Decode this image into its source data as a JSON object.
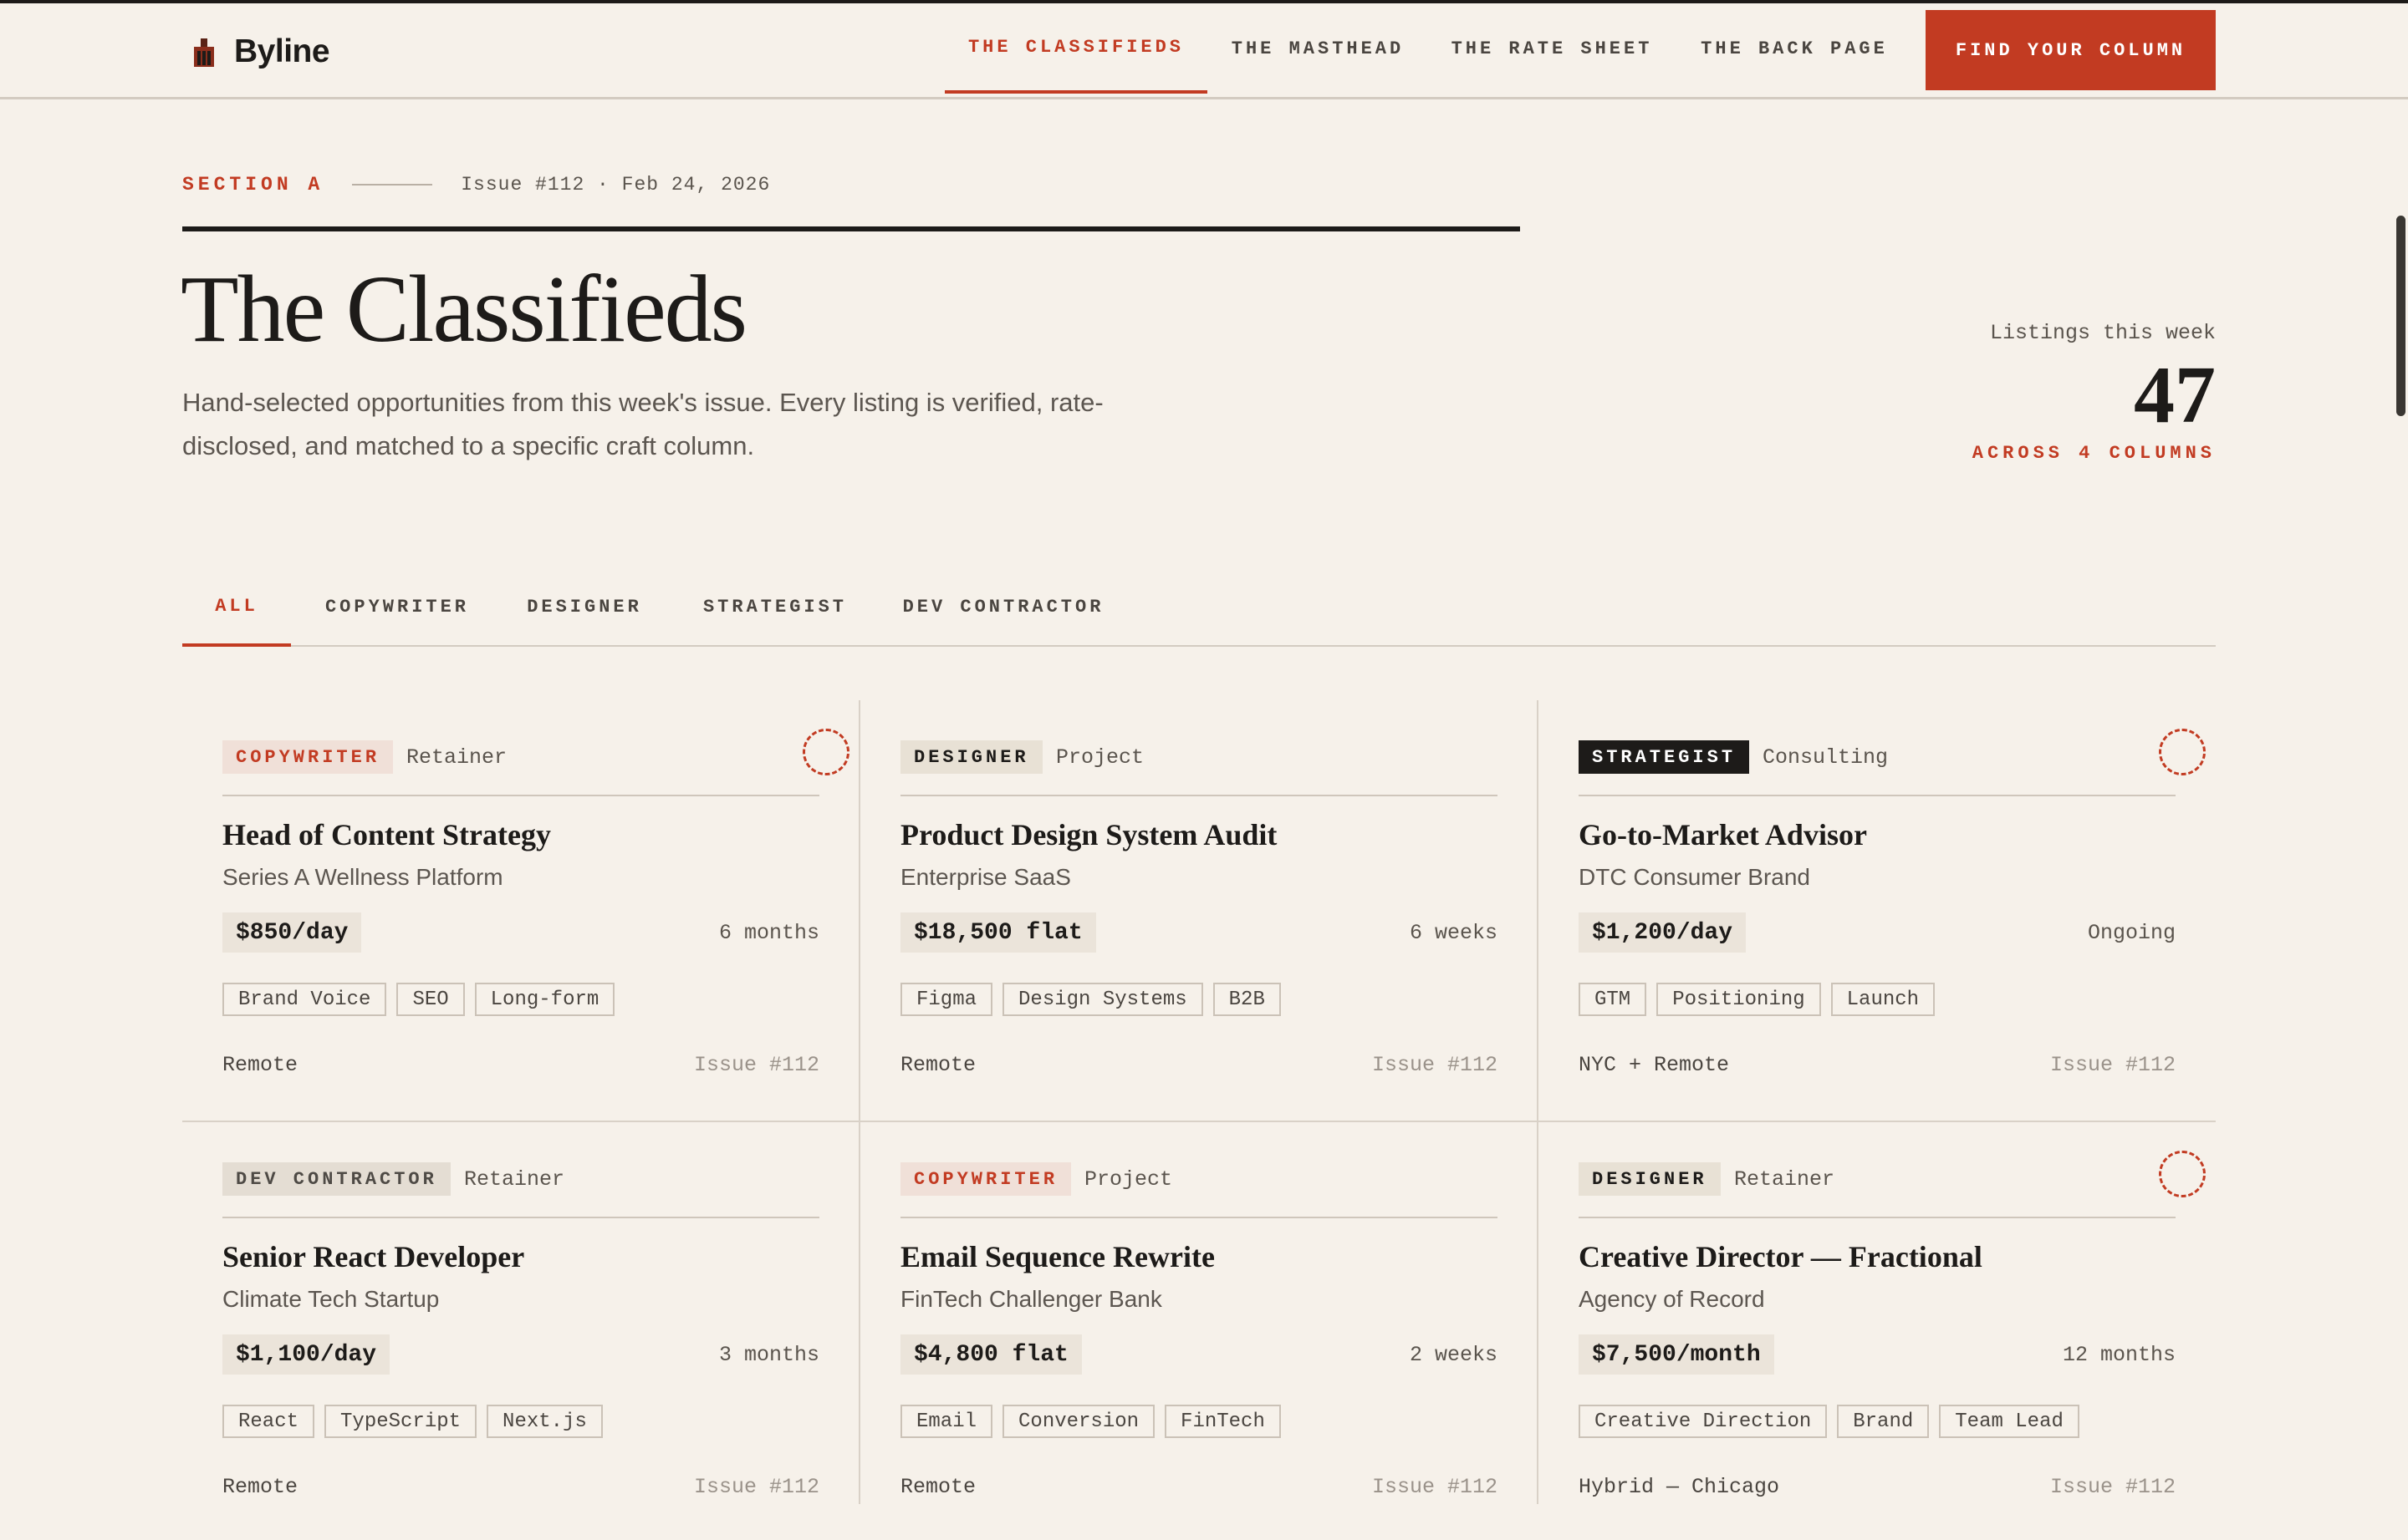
{
  "brand": {
    "name": "Byline",
    "logo_icon": "building-icon"
  },
  "nav": {
    "links": [
      "THE CLASSIFIEDS",
      "THE MASTHEAD",
      "THE RATE SHEET",
      "THE BACK PAGE"
    ],
    "active_index": 0,
    "cta": "FIND YOUR COLUMN"
  },
  "header": {
    "section": "SECTION A",
    "issue": "Issue #112 · Feb 24, 2026",
    "title": "The Classifieds",
    "description": "Hand-selected opportunities from this week's issue. Every listing is verified, rate-disclosed, and matched to a specific craft column.",
    "stat_label": "Listings this week",
    "stat_value": "47",
    "stat_sub": "ACROSS 4 COLUMNS"
  },
  "filters": {
    "tabs": [
      "ALL",
      "COPYWRITER",
      "DESIGNER",
      "STRATEGIST",
      "DEV CONTRACTOR"
    ],
    "active_index": 0
  },
  "listings": [
    {
      "category": "COPYWRITER",
      "type": "Retainer",
      "saved_marker": true,
      "title": "Head of Content Strategy",
      "client": "Series A Wellness Platform",
      "rate": "$850/day",
      "duration": "6 months",
      "tags": [
        "Brand Voice",
        "SEO",
        "Long-form"
      ],
      "location": "Remote",
      "issue": "Issue #112"
    },
    {
      "category": "DESIGNER",
      "type": "Project",
      "saved_marker": false,
      "title": "Product Design System Audit",
      "client": "Enterprise SaaS",
      "rate": "$18,500 flat",
      "duration": "6 weeks",
      "tags": [
        "Figma",
        "Design Systems",
        "B2B"
      ],
      "location": "Remote",
      "issue": "Issue #112"
    },
    {
      "category": "STRATEGIST",
      "type": "Consulting",
      "saved_marker": true,
      "title": "Go-to-Market Advisor",
      "client": "DTC Consumer Brand",
      "rate": "$1,200/day",
      "duration": "Ongoing",
      "tags": [
        "GTM",
        "Positioning",
        "Launch"
      ],
      "location": "NYC + Remote",
      "issue": "Issue #112"
    },
    {
      "category": "DEV CONTRACTOR",
      "type": "Retainer",
      "saved_marker": false,
      "title": "Senior React Developer",
      "client": "Climate Tech Startup",
      "rate": "$1,100/day",
      "duration": "3 months",
      "tags": [
        "React",
        "TypeScript",
        "Next.js"
      ],
      "location": "Remote",
      "issue": "Issue #112"
    },
    {
      "category": "COPYWRITER",
      "type": "Project",
      "saved_marker": false,
      "title": "Email Sequence Rewrite",
      "client": "FinTech Challenger Bank",
      "rate": "$4,800 flat",
      "duration": "2 weeks",
      "tags": [
        "Email",
        "Conversion",
        "FinTech"
      ],
      "location": "Remote",
      "issue": "Issue #112"
    },
    {
      "category": "DESIGNER",
      "type": "Retainer",
      "saved_marker": true,
      "title": "Creative Director — Fractional",
      "client": "Agency of Record",
      "rate": "$7,500/month",
      "duration": "12 months",
      "tags": [
        "Creative Direction",
        "Brand",
        "Team Lead"
      ],
      "location": "Hybrid — Chicago",
      "issue": "Issue #112"
    }
  ],
  "colors": {
    "accent": "#c23b22",
    "background": "#f6f1ea",
    "ink": "#1d1b19"
  }
}
